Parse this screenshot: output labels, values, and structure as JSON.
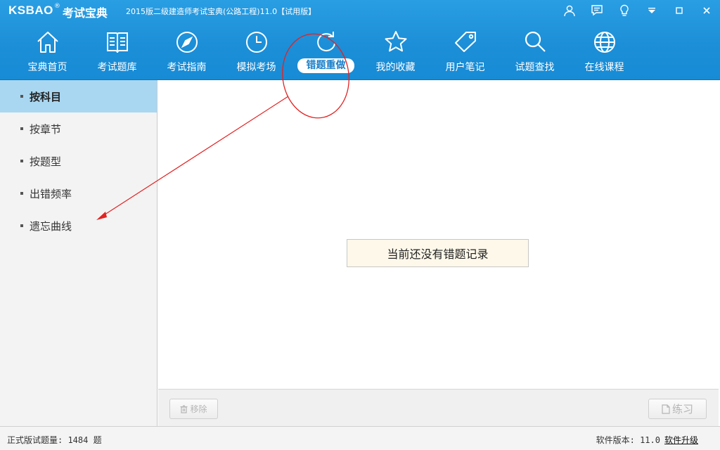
{
  "app": {
    "logo_text": "KSBAO",
    "logo_reg": "®",
    "logo_cn": "考试宝典",
    "title": "2015版二级建造师考试宝典(公路工程)11.0【试用版】"
  },
  "window_icons": [
    "user-icon",
    "message-icon",
    "lightbulb-icon",
    "dropdown-icon",
    "minimize-icon",
    "close-icon"
  ],
  "nav": {
    "items": [
      {
        "label": "宝典首页",
        "icon": "home-icon"
      },
      {
        "label": "考试题库",
        "icon": "book-icon"
      },
      {
        "label": "考试指南",
        "icon": "compass-icon"
      },
      {
        "label": "模拟考场",
        "icon": "clock-icon"
      },
      {
        "label": "错题重做",
        "icon": "redo-icon",
        "active": true
      },
      {
        "label": "我的收藏",
        "icon": "star-icon"
      },
      {
        "label": "用户笔记",
        "icon": "tag-icon"
      },
      {
        "label": "试题查找",
        "icon": "search-icon"
      },
      {
        "label": "在线课程",
        "icon": "globe-icon"
      }
    ]
  },
  "sidebar": {
    "items": [
      {
        "label": "按科目",
        "active": true
      },
      {
        "label": "按章节"
      },
      {
        "label": "按题型"
      },
      {
        "label": "出错频率"
      },
      {
        "label": "遗忘曲线"
      }
    ]
  },
  "main": {
    "empty_message": "当前还没有错题记录"
  },
  "bottom": {
    "remove_label": "移除",
    "practice_label": "练习"
  },
  "status": {
    "question_count": "正式版试题量: 1484 题",
    "version": "软件版本: 11.0",
    "upgrade_label": "软件升级"
  },
  "colors": {
    "header_blue": "#1c8fd8",
    "sidebar_active": "#a9d7f1",
    "annotation_red": "#e32222"
  }
}
